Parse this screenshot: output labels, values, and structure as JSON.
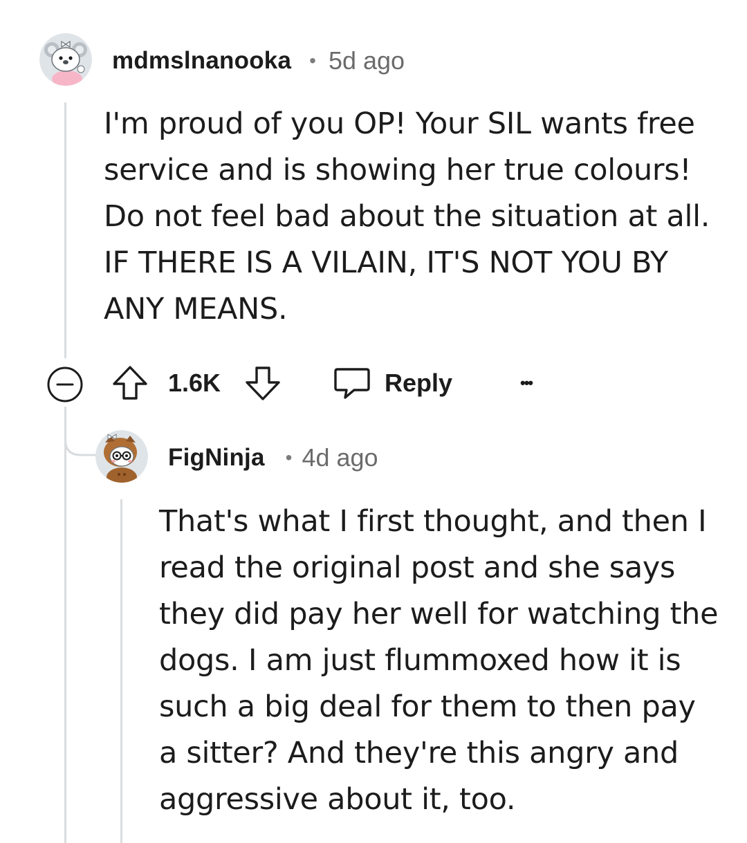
{
  "comment": {
    "username": "mdmslnanooka",
    "separator": "•",
    "timestamp": "5d ago",
    "body_lines": [
      "I'm proud of you OP! Your SIL wants free",
      "service and is showing her true colours!",
      "Do not feel bad about the situation at all.",
      "IF THERE IS A VILAIN, IT'S NOT YOU BY",
      "ANY MEANS."
    ],
    "vote_count": "1.6K",
    "reply_label": "Reply",
    "more_label": "•••"
  },
  "reply": {
    "username": "FigNinja",
    "separator": "•",
    "timestamp": "4d ago",
    "body_lines": [
      "That's what I first thought, and then I",
      "read the original post and she says",
      "they did pay her well for watching the",
      "dogs. I am just flummoxed how it is",
      "such a big deal for them to then pay",
      "a sitter? And they're this angry and",
      "aggressive about it, too."
    ]
  },
  "colors": {
    "text": "#1c1c1c",
    "meta": "#6b6b6b",
    "thread_line": "#d9dcdf"
  }
}
